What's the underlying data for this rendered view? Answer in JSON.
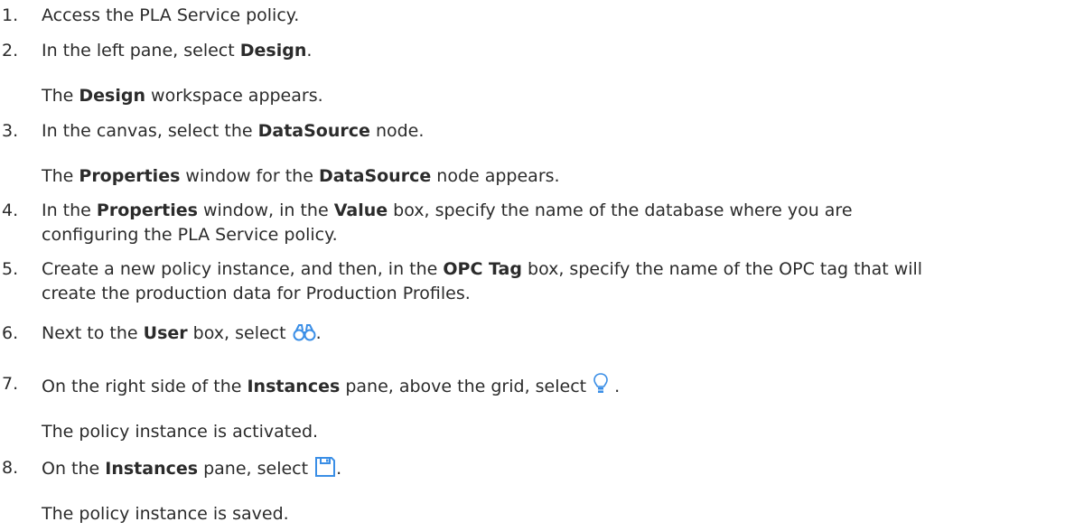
{
  "steps": [
    {
      "number": "1.",
      "parts": [
        "Access the PLA Service policy."
      ]
    },
    {
      "number": "2.",
      "parts": [
        "In the left pane, select ",
        "Design",
        "."
      ],
      "note": [
        "The ",
        "Design",
        " workspace appears."
      ]
    },
    {
      "number": "3.",
      "parts": [
        "In the canvas, select the ",
        "DataSource",
        " node."
      ],
      "note": [
        "The ",
        "Properties",
        " window for the ",
        "DataSource",
        " node appears."
      ]
    },
    {
      "number": "4.",
      "parts": [
        "In the ",
        "Properties",
        " window, in the ",
        "Value",
        " box, specify the name of the database where you are",
        "configuring the PLA Service policy."
      ]
    },
    {
      "number": "5.",
      "parts": [
        "Create a new policy instance, and then, in the ",
        "OPC Tag",
        " box, specify the name of the OPC tag that will",
        "create the production data for Production Profiles."
      ]
    },
    {
      "number": "6.",
      "parts": [
        "Next to the ",
        "User",
        " box, select ",
        "."
      ],
      "icon": "binoculars-icon"
    },
    {
      "number": "7.",
      "parts": [
        "On the right side of the ",
        "Instances",
        " pane, above the grid, select ",
        " ."
      ],
      "icon": "lightbulb-icon",
      "note": [
        "The policy instance is activated."
      ]
    },
    {
      "number": "8.",
      "parts": [
        "On the ",
        "Instances",
        " pane, select ",
        "."
      ],
      "icon": "save-icon",
      "note": [
        "The policy instance is saved."
      ]
    }
  ],
  "colors": {
    "text": "#2b2b2b",
    "icon_blue": "#3a8ee6"
  }
}
